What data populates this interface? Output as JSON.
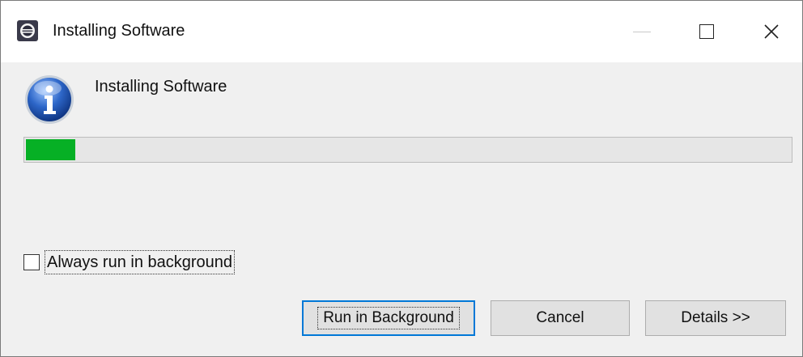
{
  "window": {
    "title": "Installing Software",
    "app_icon": "eclipse-icon",
    "controls": {
      "minimize": "minimize-icon",
      "maximize": "maximize-icon",
      "close_label": "✕"
    }
  },
  "dialog": {
    "icon": "info-icon",
    "message": "Installing Software",
    "progress_fraction": 0.065,
    "progress_color": "#06b025",
    "checkbox": {
      "label": "Always run in background",
      "checked": false
    },
    "buttons": {
      "run_in_background": "Run in Background",
      "cancel": "Cancel",
      "details": "Details >>"
    },
    "accent_color": "#0078d7"
  }
}
